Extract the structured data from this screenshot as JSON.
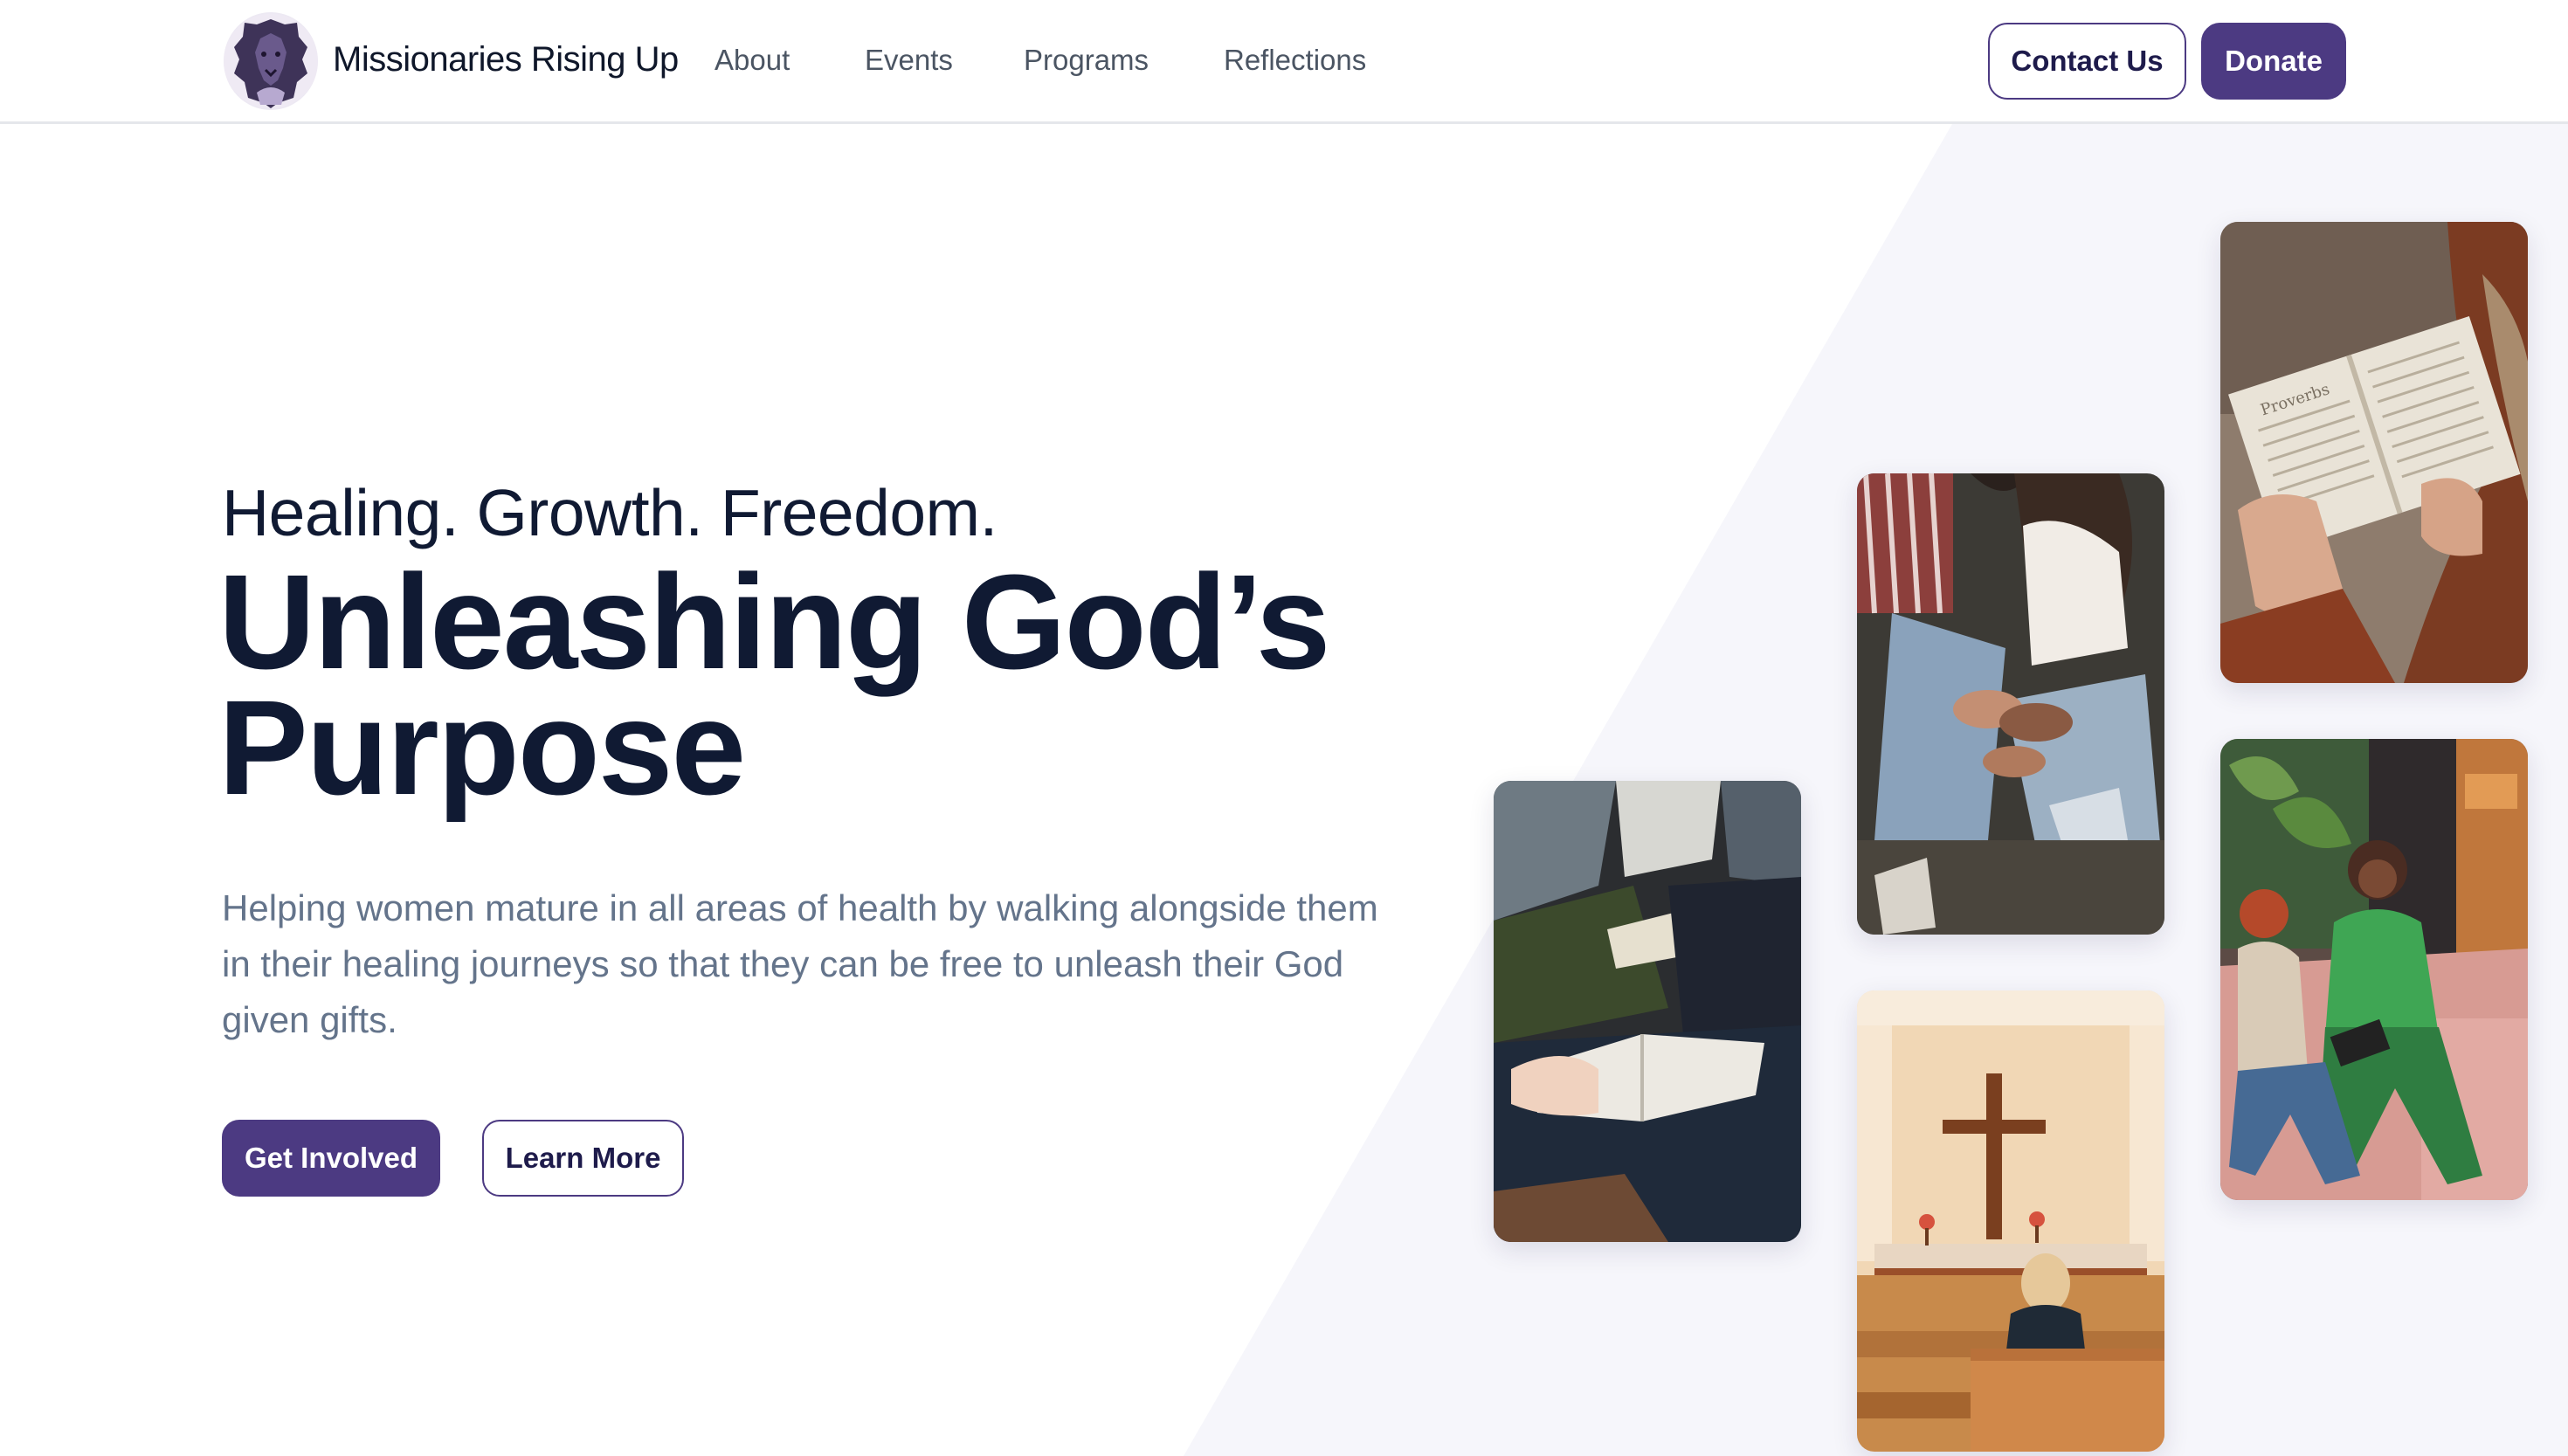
{
  "header": {
    "brand": "Missionaries Rising Up",
    "nav": [
      {
        "label": "About"
      },
      {
        "label": "Events"
      },
      {
        "label": "Programs"
      },
      {
        "label": "Reflections"
      }
    ],
    "contact_label": "Contact Us",
    "donate_label": "Donate"
  },
  "hero": {
    "tagline": "Healing. Growth. Freedom.",
    "headline_line1": "Unleashing God’s",
    "headline_line2": "Purpose",
    "description": "Helping women mature in all areas of health by walking alongside them in their healing journeys so that they can be free to unleash their God given gifts.",
    "primary_cta": "Get Involved",
    "secondary_cta": "Learn More"
  },
  "photos": [
    {
      "name": "bible-reading-photo",
      "book_text": "Proverbs"
    },
    {
      "name": "praying-hands-photo"
    },
    {
      "name": "women-conversation-photo"
    },
    {
      "name": "notebook-study-photo"
    },
    {
      "name": "church-cross-photo"
    }
  ],
  "colors": {
    "accent": "#4c3a82",
    "heading": "#101a33",
    "body_text": "#64748b",
    "nav_text": "#4b5563",
    "background_tint": "#f6f6fb"
  }
}
